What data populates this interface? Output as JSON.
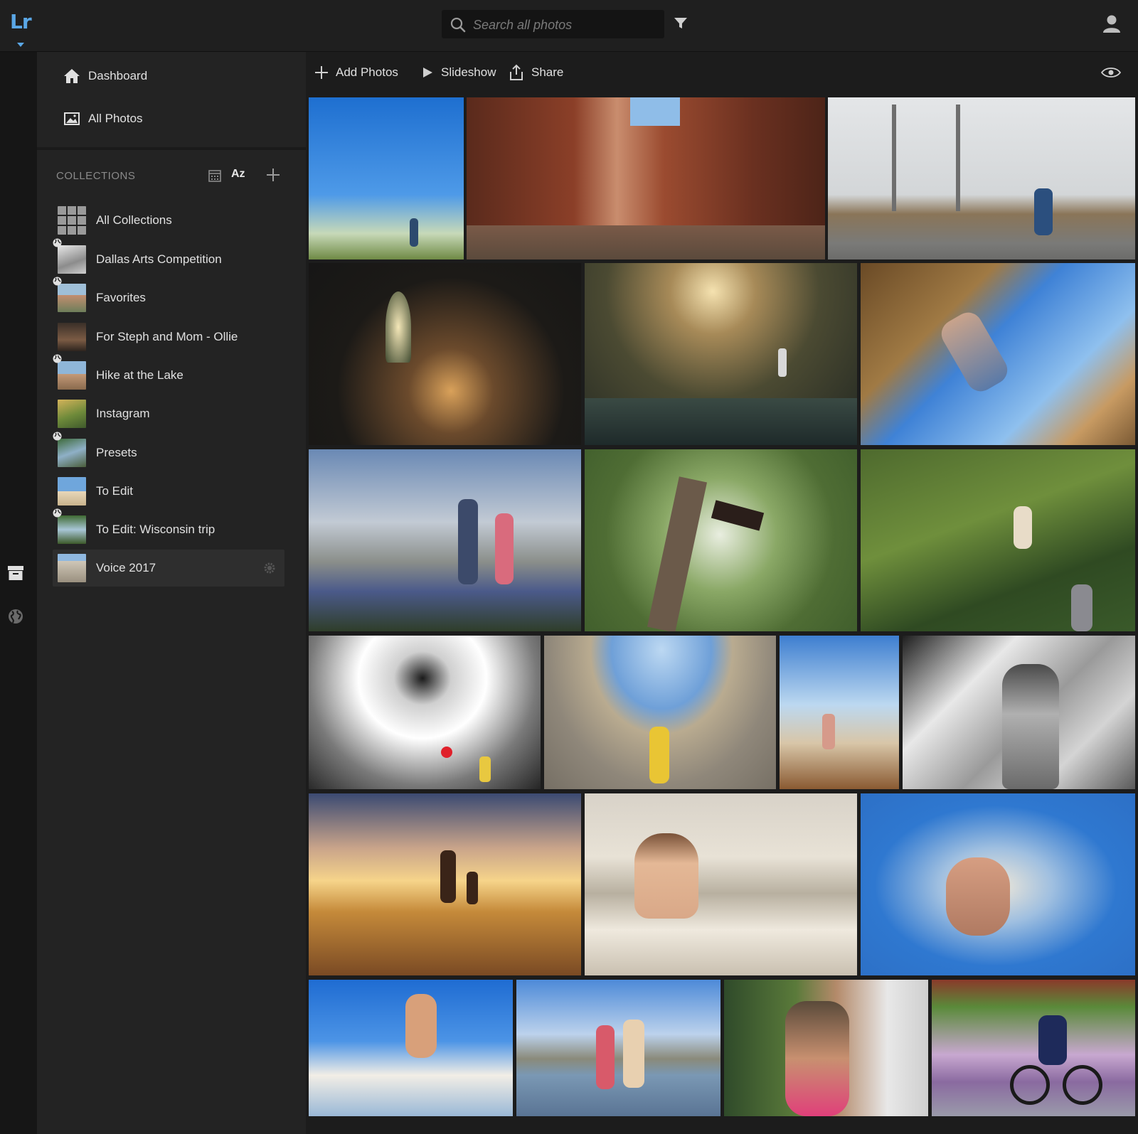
{
  "app": {
    "logo": "Lr"
  },
  "search": {
    "placeholder": "Search all photos",
    "value": ""
  },
  "nav": [
    {
      "label": "Dashboard",
      "icon": "home-icon"
    },
    {
      "label": "All Photos",
      "icon": "photo-icon"
    }
  ],
  "collections": {
    "title": "COLLECTIONS",
    "sort_label": "Az",
    "items": [
      {
        "label": "All Collections",
        "shared": false
      },
      {
        "label": "Dallas Arts Competition",
        "shared": true
      },
      {
        "label": "Favorites",
        "shared": true
      },
      {
        "label": "For Steph and Mom - Ollie",
        "shared": false
      },
      {
        "label": "Hike at the Lake",
        "shared": true
      },
      {
        "label": "Instagram",
        "shared": false
      },
      {
        "label": "Presets",
        "shared": true
      },
      {
        "label": "To Edit",
        "shared": false
      },
      {
        "label": "To Edit: Wisconsin trip",
        "shared": true
      },
      {
        "label": "Voice 2017",
        "shared": false,
        "selected": true
      }
    ]
  },
  "toolbar": {
    "add_photos": "Add Photos",
    "slideshow": "Slideshow",
    "share": "Share"
  },
  "colors": {
    "accent": "#5aa7e6",
    "background": "#1c1c1c",
    "sidebar": "#232323",
    "rail": "#161616"
  }
}
